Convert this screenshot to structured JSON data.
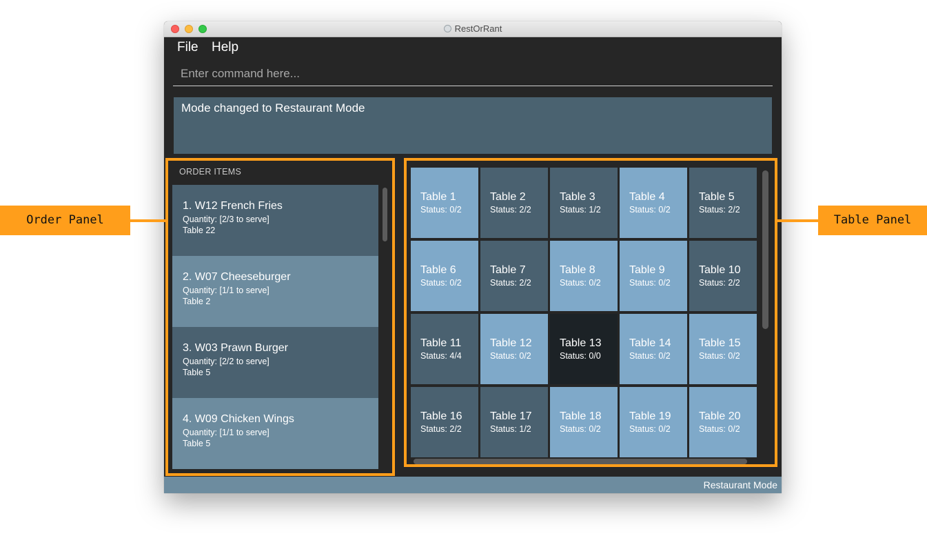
{
  "window": {
    "title": "RestOrRant"
  },
  "menu": {
    "file": "File",
    "help": "Help"
  },
  "command": {
    "placeholder": "Enter command here..."
  },
  "result": {
    "text": "Mode changed to Restaurant Mode"
  },
  "order_panel": {
    "header": "ORDER ITEMS",
    "items": [
      {
        "title": "1.  W12 French Fries",
        "quantity": "Quantity: [2/3 to serve]",
        "table": "Table 22"
      },
      {
        "title": "2.  W07 Cheeseburger",
        "quantity": "Quantity: [1/1 to serve]",
        "table": "Table 2"
      },
      {
        "title": "3.  W03 Prawn Burger",
        "quantity": "Quantity: [2/2 to serve]",
        "table": "Table 5"
      },
      {
        "title": "4.  W09 Chicken Wings",
        "quantity": "Quantity: [1/1 to serve]",
        "table": "Table 5"
      }
    ]
  },
  "tables": [
    {
      "name": "Table 1",
      "status": "Status: 0/2"
    },
    {
      "name": "Table 2",
      "status": "Status: 2/2"
    },
    {
      "name": "Table 3",
      "status": "Status: 1/2"
    },
    {
      "name": "Table 4",
      "status": "Status: 0/2"
    },
    {
      "name": "Table 5",
      "status": "Status: 2/2"
    },
    {
      "name": "Table 6",
      "status": "Status: 0/2"
    },
    {
      "name": "Table 7",
      "status": "Status: 2/2"
    },
    {
      "name": "Table 8",
      "status": "Status: 0/2"
    },
    {
      "name": "Table 9",
      "status": "Status: 0/2"
    },
    {
      "name": "Table 10",
      "status": "Status: 2/2"
    },
    {
      "name": "Table 11",
      "status": "Status: 4/4"
    },
    {
      "name": "Table 12",
      "status": "Status: 0/2"
    },
    {
      "name": "Table 13",
      "status": "Status: 0/0"
    },
    {
      "name": "Table 14",
      "status": "Status: 0/2"
    },
    {
      "name": "Table 15",
      "status": "Status: 0/2"
    },
    {
      "name": "Table 16",
      "status": "Status: 2/2"
    },
    {
      "name": "Table 17",
      "status": "Status: 1/2"
    },
    {
      "name": "Table 18",
      "status": "Status: 0/2"
    },
    {
      "name": "Table 19",
      "status": "Status: 0/2"
    },
    {
      "name": "Table 20",
      "status": "Status: 0/2"
    }
  ],
  "statusbar": {
    "mode": "Restaurant Mode"
  },
  "annotations": {
    "order_label": "Order Panel",
    "table_label": "Table Panel"
  },
  "colors": {
    "highlight": "#ff9e1b",
    "table_free": "#7fa9c9",
    "table_occupied": "#4a6170",
    "table_empty": "#1c2226"
  }
}
